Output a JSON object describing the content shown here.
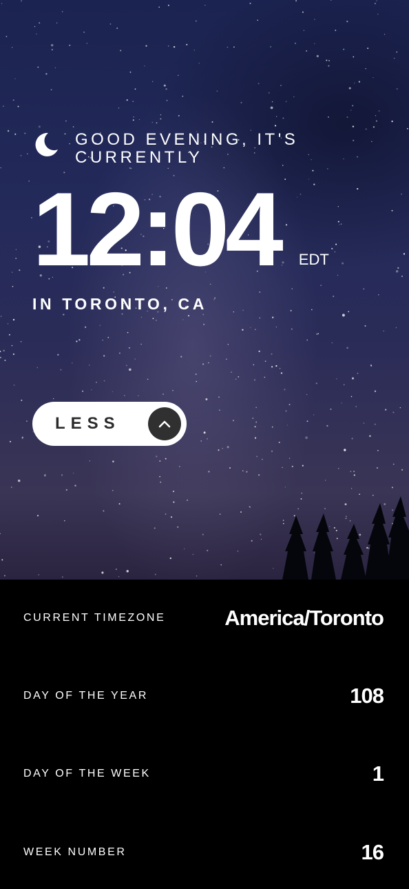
{
  "greeting": {
    "text": "GOOD EVENING, IT'S CURRENTLY",
    "icon": "moon-icon"
  },
  "clock": {
    "time": "12:04",
    "timezone_abbr": "EDT"
  },
  "location": "IN TORONTO, CA",
  "toggle": {
    "label": "LESS",
    "icon": "chevron-up-icon"
  },
  "details": {
    "timezone": {
      "label": "CURRENT TIMEZONE",
      "value": "America/Toronto"
    },
    "day_of_year": {
      "label": "DAY OF THE YEAR",
      "value": "108"
    },
    "day_of_week": {
      "label": "DAY OF THE WEEK",
      "value": "1"
    },
    "week_number": {
      "label": "WEEK NUMBER",
      "value": "16"
    }
  },
  "colors": {
    "sky": "#232a5a",
    "panel": "#000000",
    "button": "#ffffff",
    "button_circle": "#303030"
  }
}
